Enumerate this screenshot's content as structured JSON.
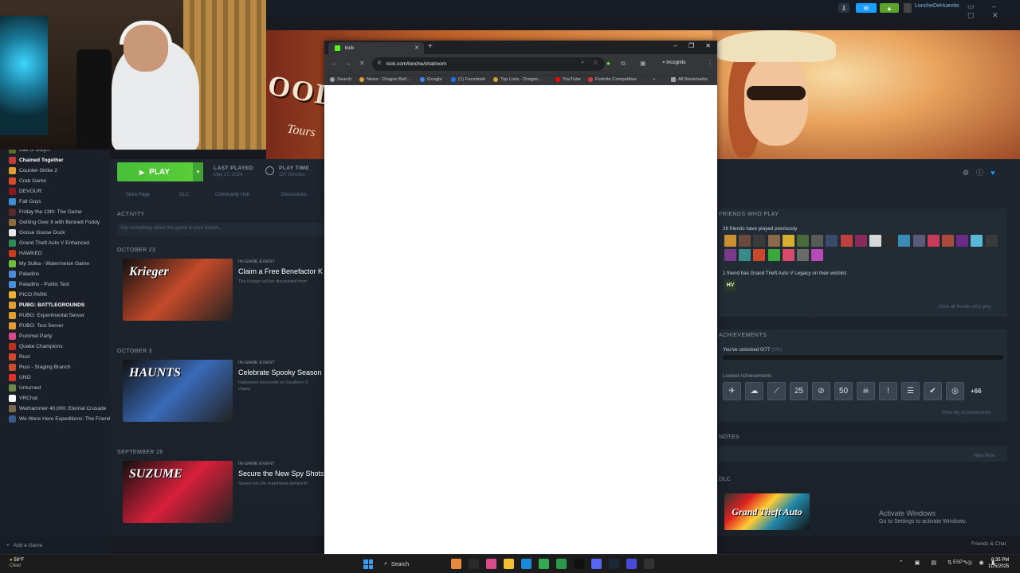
{
  "steam": {
    "username": "LoncheDeHuevito",
    "library": [
      {
        "name": "Call of Duty®",
        "color": "#5a6b2d"
      },
      {
        "name": "Chained Together",
        "color": "#c23b3b",
        "bold": true
      },
      {
        "name": "Counter-Strike 2",
        "color": "#e0a030"
      },
      {
        "name": "Crab Game",
        "color": "#d84a2a"
      },
      {
        "name": "DEVOUR",
        "color": "#8a1a1a"
      },
      {
        "name": "Fall Guys",
        "color": "#3c8ed8"
      },
      {
        "name": "Friday the 13th: The Game",
        "color": "#5a2a2a"
      },
      {
        "name": "Getting Over It with Bennett Foddy",
        "color": "#8b6b3a"
      },
      {
        "name": "Goose Goose Duck",
        "color": "#e8e8e8"
      },
      {
        "name": "Grand Theft Auto V Enhanced",
        "color": "#2e8b57"
      },
      {
        "name": "HAWKED",
        "color": "#cc3a1a"
      },
      {
        "name": "My Sulka - Watermelon Game",
        "color": "#6bbf3a"
      },
      {
        "name": "Paladins",
        "color": "#4a8ed8"
      },
      {
        "name": "Paladins - Public Test",
        "color": "#4a8ed8"
      },
      {
        "name": "PICO PARK",
        "color": "#f0b030"
      },
      {
        "name": "PUBG: BATTLEGROUNDS",
        "color": "#e0a030",
        "bold": true
      },
      {
        "name": "PUBG: Experimental Server",
        "color": "#e0a030"
      },
      {
        "name": "PUBG: Test Server",
        "color": "#e0a030"
      },
      {
        "name": "Pummel Party",
        "color": "#d84a8a"
      },
      {
        "name": "Quake Champions",
        "color": "#c0301a"
      },
      {
        "name": "Rust",
        "color": "#cd4a2a"
      },
      {
        "name": "Rust - Staging Branch",
        "color": "#cd4a2a"
      },
      {
        "name": "UNO",
        "color": "#e0302a"
      },
      {
        "name": "Unturned",
        "color": "#6a8a4a"
      },
      {
        "name": "VRChat",
        "color": "#ffffff"
      },
      {
        "name": "Warhammer 40,000: Eternal Crusade",
        "color": "#7a6a4a"
      },
      {
        "name": "We Were Here Expeditions: The Friend",
        "color": "#3a5a8a"
      }
    ],
    "add_game": "Add a Game",
    "play_label": "PLAY",
    "last_played_label": "LAST PLAYED",
    "last_played_value": "May 17, 2024",
    "play_time_label": "PLAY TIME",
    "play_time_value": "137 minutes",
    "subnav": [
      "Store Page",
      "DLC",
      "Community Hub",
      "Discussions"
    ],
    "activity_label": "ACTIVITY",
    "activity_placeholder": "Say something about this game to your friends...",
    "events": [
      {
        "date": "OCTOBER 23",
        "kind": "IN-GAME EVENT",
        "title": "Claim a Free Benefactor K",
        "desc": "The Krieger will be discounted from",
        "art": "Krieger",
        "artcolor": "#c44a2a"
      },
      {
        "date": "OCTOBER 3",
        "kind": "IN-GAME EVENT",
        "title": "Celebrate Spooky Season",
        "desc": "Halloween descends on Southern S",
        "desc2": "chaos.",
        "art": "HAUNTS",
        "artcolor": "#3a6ab8"
      },
      {
        "date": "SEPTEMBER 26",
        "kind": "IN-GAME EVENT",
        "title": "Secure the New Spy Shots",
        "desc": "Speed into the mainframe behind th",
        "art": "SUZUME",
        "artcolor": "#d8203a"
      }
    ],
    "friends_who_play": "FRIENDS WHO PLAY",
    "friends_played": "26 friends have played previously",
    "friends_wishlist": "1 friend has Grand Theft Auto V Legacy on their wishlist",
    "view_all_friends": "View all friends who play",
    "achievements_label": "ACHIEVEMENTS",
    "achievements_unlocked": "You've unlocked 0/77",
    "achievements_pct": "(0%)",
    "achievements_fraction": 0,
    "locked_achievements": "Locked Achievements",
    "achievement_icons": [
      "✈",
      "☁",
      "⟋",
      "25",
      "⊘",
      "50",
      "☠",
      "!",
      "☰",
      "✔",
      "◎"
    ],
    "more_achievements": "+66",
    "view_achievements": "View My Achievements",
    "notes_label": "NOTES",
    "new_note": "New Note",
    "dlc_label": "DLC",
    "friends_chat": "Friends & Chat",
    "hero_text": "OOD",
    "hero_sub": "Tours"
  },
  "chrome": {
    "tab_title": "kick",
    "url": "kick.com/lonche/chatroom",
    "incognito": "Incognito",
    "bookmarks": [
      {
        "label": "Search",
        "color": "#9aa0a6"
      },
      {
        "label": "News - Dragon Ball...",
        "color": "#e0a030"
      },
      {
        "label": "Google",
        "color": "#4285f4"
      },
      {
        "label": "(1) Facebook",
        "color": "#1877f2"
      },
      {
        "label": "Top Lista - Dragon...",
        "color": "#e0a030"
      },
      {
        "label": "YouTube",
        "color": "#ff0000"
      },
      {
        "label": "Fortnite Competitive",
        "color": "#d83a3a"
      }
    ],
    "all_bookmarks": "All Bookmarks"
  },
  "windows": {
    "activate_title": "Activate Windows",
    "activate_sub": "Go to Settings to activate Windows.",
    "weather_temp": "58°F",
    "weather_desc": "Clear",
    "search": "Search",
    "lang": "ESP",
    "time": "8:35 PM",
    "date": "11/5/2025"
  }
}
